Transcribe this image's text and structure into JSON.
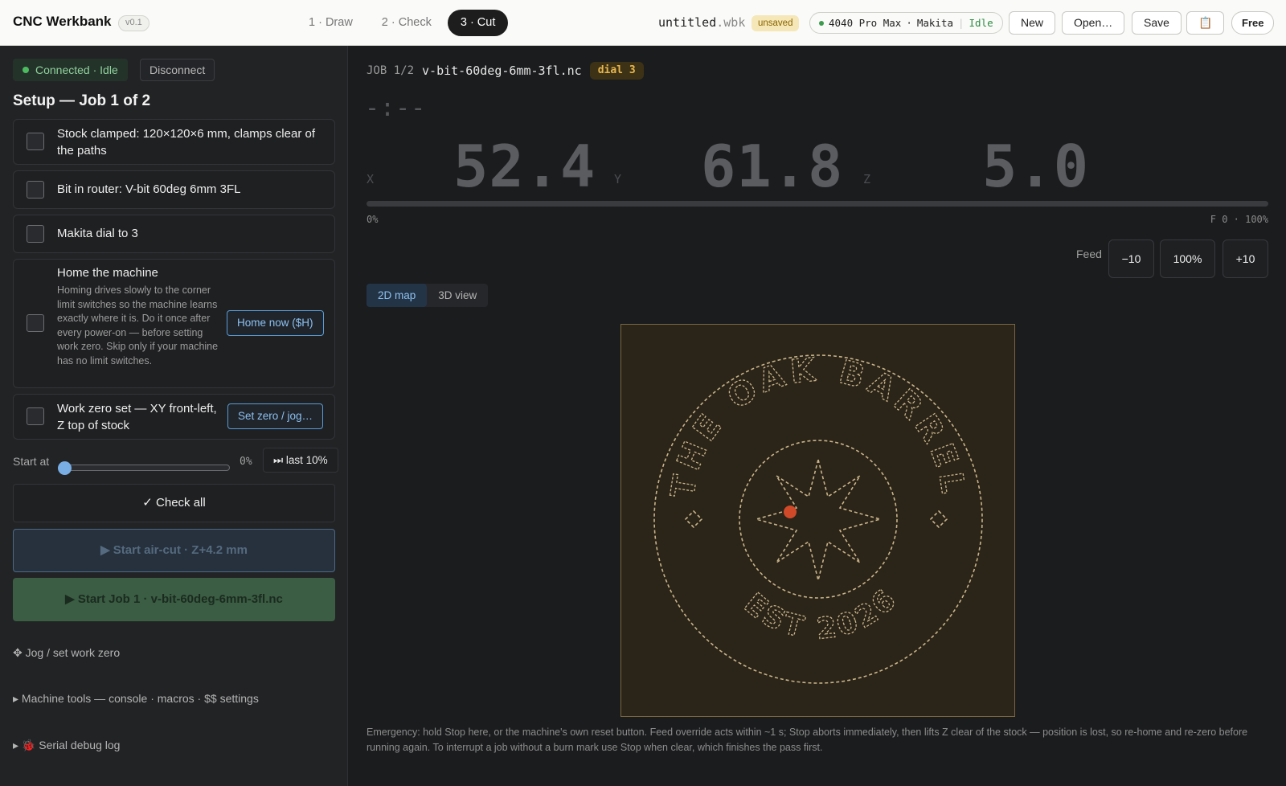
{
  "header": {
    "brand": "CNC Werkbank",
    "version": "v0.1",
    "steps": [
      "1 · Draw",
      "2 · Check",
      "3 · Cut"
    ],
    "active_step": 2,
    "file_name": "untitled",
    "file_ext": ".wbk",
    "unsaved_label": "unsaved",
    "machine": "4040 Pro Max",
    "router": "Makita",
    "machine_state": "Idle",
    "buttons": {
      "new": "New",
      "open": "Open…",
      "save": "Save",
      "clipboard": "📋",
      "free": "Free"
    }
  },
  "sidebar": {
    "connection_status": "Connected · Idle",
    "disconnect_label": "Disconnect",
    "setup_title": "Setup — Job 1 of 2",
    "checklist": [
      {
        "label": "Stock clamped: 120×120×6 mm, clamps clear of the paths",
        "checked": false
      },
      {
        "label": "Bit in router: V-bit 60deg 6mm 3FL",
        "checked": false
      },
      {
        "label": "Makita dial to 3",
        "checked": false
      },
      {
        "label": "Home the machine",
        "description": "Homing drives slowly to the corner limit switches so the machine learns exactly where it is. Do it once after every power-on — before setting work zero. Skip only if your machine has no limit switches.",
        "action": "Home now ($H)",
        "checked": false
      },
      {
        "label": "Work zero set — XY front-left, Z top of stock",
        "action": "Set zero / jog…",
        "checked": false
      }
    ],
    "start_at_label": "Start at",
    "start_at_value": "0%",
    "last10_label": "⏭ last 10%",
    "check_all_label": "✓ Check all",
    "air_cut_label": "▶ Start air-cut · Z+4.2 mm",
    "start_job_label": "▶ Start Job 1 · v-bit-60deg-6mm-3fl.nc",
    "sections": [
      "✥ Jog / set work zero",
      "▸ Machine tools — console · macros · $$ settings",
      "▸ 🐞 Serial debug log"
    ]
  },
  "main": {
    "job_number": "JOB 1/2",
    "job_file": "v-bit-60deg-6mm-3fl.nc",
    "dial_badge": "dial 3",
    "timer": "-:--",
    "axes": [
      {
        "label": "X",
        "value": "52.4"
      },
      {
        "label": "Y",
        "value": "61.8"
      },
      {
        "label": "Z",
        "value": "5.0"
      }
    ],
    "progress_fraction": 0,
    "progress_left": "0%",
    "progress_right": "F 0 · 100%",
    "feed_label": "Feed",
    "feed_buttons": [
      "−10",
      "100%",
      "+10"
    ],
    "view_tabs": [
      "2D map",
      "3D view"
    ],
    "active_view": 0,
    "map_text_top": "THE OAK BARREL",
    "map_text_bottom": "EST 2026",
    "emergency_note": "Emergency: hold Stop here, or the machine's own reset button. Feed override acts within ~1 s; Stop aborts immediately, then lifts Z clear of the stock — position is lost, so re-home and re-zero before running again. To interrupt a job without a burn mark use Stop when clear, which finishes the pass first."
  },
  "colors": {
    "accent_blue": "#79aee4",
    "connected_green": "#4cbb5f",
    "map_toolpath": "#c9b48a",
    "map_tool_dot": "#d04a2a",
    "dial_amber": "#e7b64e"
  }
}
